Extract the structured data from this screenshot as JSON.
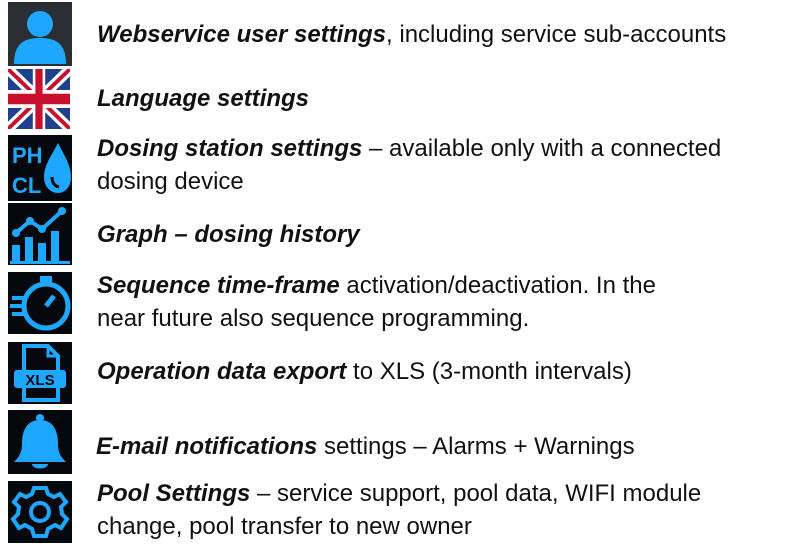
{
  "colors": {
    "icon_accent": "#1ea7ff",
    "icon_bg": "#05080c"
  },
  "items": [
    {
      "icon": "user-icon",
      "title": "Webservice user settings",
      "desc": ", including service sub-accounts",
      "desc2": ""
    },
    {
      "icon": "uk-flag-icon",
      "title": "Language settings",
      "desc": "",
      "desc2": ""
    },
    {
      "icon": "ph-cl-drop-icon",
      "title": "Dosing station settings",
      "desc": " – available only with a connected",
      "desc2": "dosing device"
    },
    {
      "icon": "graph-icon",
      "title": "Graph – dosing history",
      "desc": "",
      "desc2": ""
    },
    {
      "icon": "stopwatch-icon",
      "title": "Sequence time-frame",
      "desc": " activation/deactivation. In the",
      "desc2": "near future also sequence programming."
    },
    {
      "icon": "xls-file-icon",
      "title": "Operation data export",
      "desc": " to XLS (3-month intervals)",
      "desc2": ""
    },
    {
      "icon": "bell-icon",
      "title": "E-mail notifications",
      "desc": " settings – Alarms + Warnings",
      "desc2": ""
    },
    {
      "icon": "gear-icon",
      "title": "Pool Settings",
      "desc": " – service support, pool data, WIFI module",
      "desc2": "change, pool transfer to new owner"
    }
  ]
}
